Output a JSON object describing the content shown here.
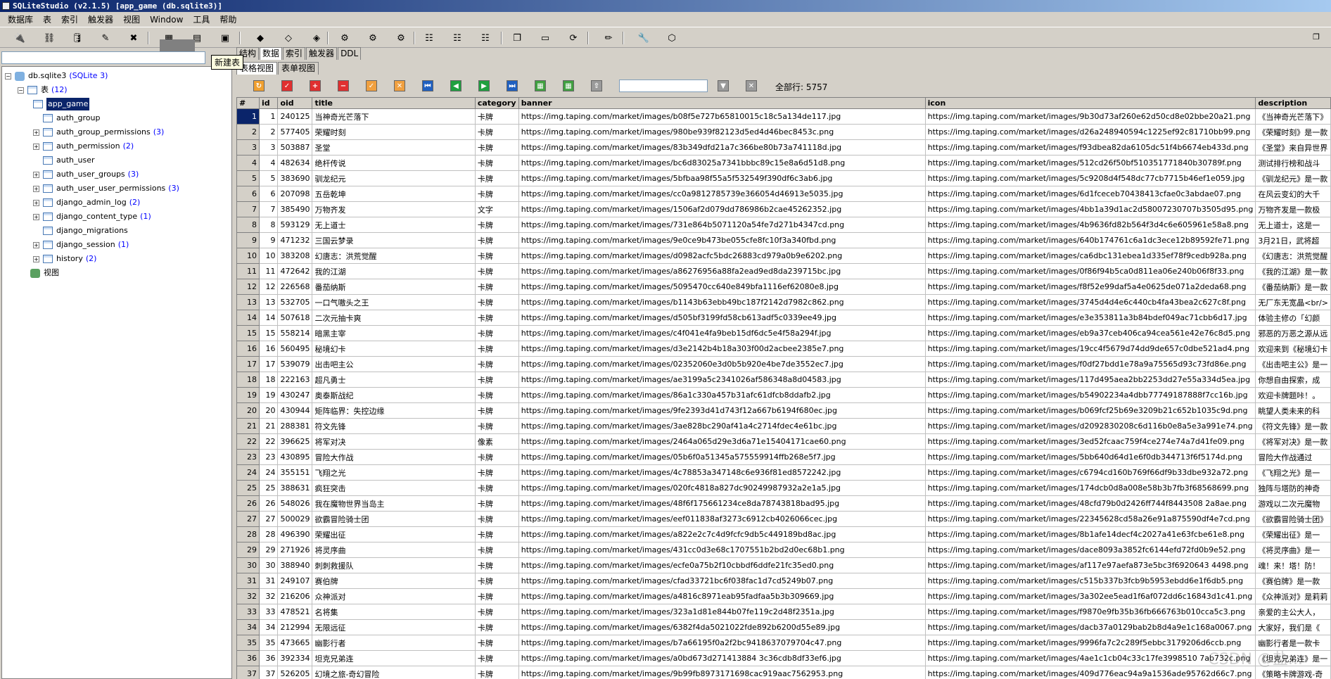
{
  "window": {
    "title": "SQLiteStudio (v2.1.5) [app_game (db.sqlite3)]"
  },
  "menu": [
    "数据库",
    "表",
    "索引",
    "触发器",
    "视图",
    "Window",
    "工具",
    "帮助"
  ],
  "tooltip": "新建表",
  "object_tabs": [
    "结构",
    "数据",
    "索引",
    "触发器",
    "DDL"
  ],
  "view_tabs": [
    "表格视图",
    "表单视图"
  ],
  "total_rows_label": "全部行: 5757",
  "tree": {
    "db_label": "db.sqlite3",
    "db_type": "(SQLite 3)",
    "tables_label": "表",
    "tables_count": "(12)",
    "views_label": "视图",
    "tables": [
      {
        "name": "app_game",
        "count": ""
      },
      {
        "name": "auth_group",
        "count": ""
      },
      {
        "name": "auth_group_permissions",
        "count": "(3)"
      },
      {
        "name": "auth_permission",
        "count": "(2)"
      },
      {
        "name": "auth_user",
        "count": ""
      },
      {
        "name": "auth_user_groups",
        "count": "(3)"
      },
      {
        "name": "auth_user_user_permissions",
        "count": "(3)"
      },
      {
        "name": "django_admin_log",
        "count": "(2)"
      },
      {
        "name": "django_content_type",
        "count": "(1)"
      },
      {
        "name": "django_migrations",
        "count": ""
      },
      {
        "name": "django_session",
        "count": "(1)"
      },
      {
        "name": "history",
        "count": "(2)"
      }
    ]
  },
  "columns": [
    "#",
    "id",
    "oid",
    "title",
    "category",
    "banner",
    "icon",
    "description"
  ],
  "rows": [
    [
      "1",
      "1",
      "240125",
      "当神奇光芒落下",
      "卡牌",
      "https://img.taping.com/market/images/b08f5e727b65810015c18c5a134de117.jpg",
      "https://img.taping.com/market/images/9b30d73af260e62d50cd8e02bbe20a21.png",
      "《当神奇光芒落下》"
    ],
    [
      "2",
      "2",
      "577405",
      "荣耀时刻",
      "卡牌",
      "https://img.taping.com/market/images/980be939f82123d5ed4d46bec8453c.png",
      "https://img.taping.com/market/images/d26a248940594c1225ef92c81710bb99.png",
      "《荣耀时刻》是一款"
    ],
    [
      "3",
      "3",
      "503887",
      "圣堂",
      "卡牌",
      "https://img.taping.com/market/images/83b349dfd21a7c366be80b73a741118d.jpg",
      "https://img.taping.com/market/images/f93dbea82da6105dc51f4b6674eb433d.png",
      "《圣堂》来自异世界"
    ],
    [
      "4",
      "4",
      "482634",
      "绝杆传说",
      "卡牌",
      "https://img.taping.com/market/images/bc6d83025a7341bbbc89c15e8a6d51d8.png",
      "https://img.taping.com/market/images/512cd26f50bf510351771840b30789f.png",
      "测试排行榜和战斗"
    ],
    [
      "5",
      "5",
      "383690",
      "驯龙纪元",
      "卡牌",
      "https://img.taping.com/market/images/5bfbaa98f55a5f532549f390df6c3ab6.jpg",
      "https://img.taping.com/market/images/5c9208d4f548dc77cb7715b46ef1e059.jpg",
      "《驯龙纪元》是一款"
    ],
    [
      "6",
      "6",
      "207098",
      "五岳乾坤",
      "卡牌",
      "https://img.taping.com/market/images/cc0a9812785739e366054d46913e5035.jpg",
      "https://img.taping.com/market/images/6d1fceceb70438413cfae0c3abdae07.png",
      "在风云变幻的大千"
    ],
    [
      "7",
      "7",
      "385490",
      "万物齐发",
      "文字",
      "https://img.taping.com/market/images/1506af2d079dd786986b2cae45262352.jpg",
      "https://img.taping.com/market/images/4bb1a39d1ac2d58007230707b3505d95.png",
      "万物齐发是一款极"
    ],
    [
      "8",
      "8",
      "593129",
      "无上道士",
      "卡牌",
      "https://img.taping.com/market/images/731e864b5071120a54fe7d271b4347cd.png",
      "https://img.taping.com/market/images/4b9636fd82b564f3d4c6e605961e58a8.png",
      "无上道士，这是一"
    ],
    [
      "9",
      "9",
      "471232",
      "三国云梦录",
      "卡牌",
      "https://img.taping.com/market/images/9e0ce9b473be055cfe8fc10f3a340fbd.png",
      "https://img.taping.com/market/images/640b174761c6a1dc3ece12b89592fe71.png",
      "3月21日，武将超"
    ],
    [
      "10",
      "10",
      "383208",
      "幻唐志：洪荒觉醒",
      "卡牌",
      "https://img.taping.com/market/images/d0982acfc5bdc26883cd979a0b9e6202.png",
      "https://img.taping.com/market/images/ca6dbc131ebea1d335ef78f9cedb928a.png",
      "《幻唐志：洪荒觉醒"
    ],
    [
      "11",
      "11",
      "472642",
      "我的江湖",
      "卡牌",
      "https://img.taping.com/market/images/a86276956a88fa2ead9ed8da239715bc.jpg",
      "https://img.taping.com/market/images/0f86f94b5ca0d811ea06e240b06f8f33.png",
      "《我的江湖》是一款"
    ],
    [
      "12",
      "12",
      "226568",
      "番茄纳斯",
      "卡牌",
      "https://img.taping.com/market/images/5095470cc640e849bfa1116ef62080e8.jpg",
      "https://img.taping.com/market/images/f8f52e99daf5a4e0625de071a2deda68.png",
      "《番茄纳斯》是一款"
    ],
    [
      "13",
      "13",
      "532705",
      "一口气嗷头之王",
      "卡牌",
      "https://img.taping.com/market/images/b1143b63ebb49bc187f2142d7982c862.png",
      "https://img.taping.com/market/images/3745d4d4e6c440cb4fa43bea2c627c8f.png",
      "无厂东无宽晶<br/>"
    ],
    [
      "14",
      "14",
      "507618",
      "二次元抽卡爽",
      "卡牌",
      "https://img.taping.com/market/images/d505bf3199fd58cb613adf5c0339ee49.jpg",
      "https://img.taping.com/market/images/e3e353811a3b84bdef049ac71cbb6d17.jpg",
      "体验主修の「幻颜"
    ],
    [
      "15",
      "15",
      "558214",
      "暗黑主宰",
      "卡牌",
      "https://img.taping.com/market/images/c4f041e4fa9beb15df6dc5e4f58a294f.jpg",
      "https://img.taping.com/market/images/eb9a37ceb406ca94cea561e42e76c8d5.png",
      "邪恶的万恶之源从远"
    ],
    [
      "16",
      "16",
      "560495",
      "秘境幻卡",
      "卡牌",
      "https://img.taping.com/market/images/d3e2142b4b18a303f00d2acbee2385e7.png",
      "https://img.taping.com/market/images/19cc4f5679d74dd9de657c0dbe521ad4.png",
      "欢迎来到《秘境幻卡"
    ],
    [
      "17",
      "17",
      "539079",
      "出击吧主公",
      "卡牌",
      "https://img.taping.com/market/images/02352060e3d0b5b920e4be7de3552ec7.jpg",
      "https://img.taping.com/market/images/f0df27bdd1e78a9a75565d93c73fd86e.png",
      "《出击吧主公》是一"
    ],
    [
      "18",
      "18",
      "222163",
      "超凡勇士",
      "卡牌",
      "https://img.taping.com/market/images/ae3199a5c2341026af586348a8d04583.jpg",
      "https://img.taping.com/market/images/117d495aea2bb2253dd27e55a334d5ea.jpg",
      "你想自由探索，成"
    ],
    [
      "19",
      "19",
      "430247",
      "奥泰斯战纪",
      "卡牌",
      "https://img.taping.com/market/images/86a1c330a457b31afc61dfcb8ddafb2.jpg",
      "https://img.taping.com/market/images/b54902234a4dbb77749187888f7cc16b.jpg",
      "欢迎卡牌题咔！。"
    ],
    [
      "20",
      "20",
      "430944",
      "矩阵临界：失控边缘",
      "卡牌",
      "https://img.taping.com/market/images/9fe2393d41d743f12a667b6194f680ec.jpg",
      "https://img.taping.com/market/images/b069fcf25b69e3209b21c652b1035c9d.png",
      "眺望人类未来的科"
    ],
    [
      "21",
      "21",
      "288381",
      "符文先锋",
      "卡牌",
      "https://img.taping.com/market/images/3ae828bc290af41a4c2714fdec4e61bc.jpg",
      "https://img.taping.com/market/images/d2092830208c6d116b0e8a5e3a991e74.png",
      "《符文先锋》是一款"
    ],
    [
      "22",
      "22",
      "396625",
      "将军对决",
      "像素",
      "https://img.taping.com/market/images/2464a065d29e3d6a71e15404171cae60.png",
      "https://img.taping.com/market/images/3ed52fcaac759f4ce274e74a7d41fe09.png",
      "《将军对决》是一款"
    ],
    [
      "23",
      "23",
      "430895",
      "冒险大作战",
      "卡牌",
      "https://img.taping.com/market/images/05b6f0a51345a575559914ffb268e5f7.jpg",
      "https://img.taping.com/market/images/5bb640d64d1e6f0db344713f6f5174d.png",
      "冒险大作战通过"
    ],
    [
      "24",
      "24",
      "355151",
      "飞翔之光",
      "卡牌",
      "https://img.taping.com/market/images/4c78853a347148c6e936f81ed8572242.jpg",
      "https://img.taping.com/market/images/c6794cd160b769f66df9b33dbe932a72.png",
      "《飞翔之光》是一"
    ],
    [
      "25",
      "25",
      "388631",
      "疯狂突击",
      "卡牌",
      "https://img.taping.com/market/images/020fc4818a827dc90249987932a2e1a5.jpg",
      "https://img.taping.com/market/images/174dcb0d8a008e58b3b7fb3f68568699.png",
      "独阵与塔防的神奇"
    ],
    [
      "26",
      "26",
      "548026",
      "我在魔物世界当岛主",
      "卡牌",
      "https://img.taping.com/market/images/48f6f175661234ce8da78743818bad95.jpg",
      "https://img.taping.com/market/images/48cfd79b0d2426ff744f8443508 2a8ae.png",
      "游戏以二次元魔物"
    ],
    [
      "27",
      "27",
      "500029",
      "欲霸冒险骑士团",
      "卡牌",
      "https://img.taping.com/market/images/eef011838af3273c6912cb4026066cec.jpg",
      "https://img.taping.com/market/images/22345628cd58a26e91a875590df4e7cd.png",
      "《欲霸冒险骑士团》"
    ],
    [
      "28",
      "28",
      "496390",
      "荣耀出征",
      "卡牌",
      "https://img.taping.com/market/images/a822e2c7c4d9fcfc9db5c449189bd8ac.jpg",
      "https://img.taping.com/market/images/8b1afe14decf4c2027a41e63fcbe61e8.png",
      "《荣耀出征》是一"
    ],
    [
      "29",
      "29",
      "271926",
      "将灵序曲",
      "卡牌",
      "https://img.taping.com/market/images/431cc0d3e68c1707551b2bd2d0ec68b1.png",
      "https://img.taping.com/market/images/dace8093a3852fc6144efd72fd0b9e52.png",
      "《将灵序曲》是一"
    ],
    [
      "30",
      "30",
      "388940",
      "刺刺救援队",
      "卡牌",
      "https://img.taping.com/market/images/ecfe0a75b2f10cbbdf6ddfe21fc35ed0.png",
      "https://img.taping.com/market/images/af117e97aefa873e5bc3f6920643 4498.png",
      "魂！来！塔！防！"
    ],
    [
      "31",
      "31",
      "249107",
      "赛伯牌",
      "卡牌",
      "https://img.taping.com/market/images/cfad33721bc6f038fac1d7cd5249b07.png",
      "https://img.taping.com/market/images/c515b337b3fcb9b5953ebdd6e1f6db5.png",
      "《赛伯牌》是一款"
    ],
    [
      "32",
      "32",
      "216206",
      "众神派对",
      "卡牌",
      "https://img.taping.com/market/images/a4816c8971eab95fadfaa5b3b309669.jpg",
      "https://img.taping.com/market/images/3a302ee5ead1f6af072dd6c16843d1c41.png",
      "《众神派对》是莉莉"
    ],
    [
      "33",
      "33",
      "478521",
      "名将集",
      "卡牌",
      "https://img.taping.com/market/images/323a1d81e844b07fe119c2d48f2351a.jpg",
      "https://img.taping.com/market/images/f9870e9fb35b36fb666763b010cca5c3.png",
      "亲爱的主公大人，"
    ],
    [
      "34",
      "34",
      "212994",
      "无限远征",
      "卡牌",
      "https://img.taping.com/market/images/6382f4da5021022fde892b6200d55e89.jpg",
      "https://img.taping.com/market/images/dacb37a0129bab2b8d4a9e1c168a0067.png",
      "大家好，我们是《"
    ],
    [
      "35",
      "35",
      "473665",
      "幽影行者",
      "卡牌",
      "https://img.taping.com/market/images/b7a66195f0a2f2bc9418637079704c47.png",
      "https://img.taping.com/market/images/9996fa7c2c289f5ebbc3179206d6ccb.png",
      "幽影行者是一款卡"
    ],
    [
      "36",
      "36",
      "392334",
      "坦克兄弟连",
      "卡牌",
      "https://img.taping.com/market/images/a0bd673d271413884 3c36cdb8df33ef6.jpg",
      "https://img.taping.com/market/images/4ae1c1cb04c33c17fe3998510 7ab732c.png",
      "《坦克兄弟连》是一"
    ],
    [
      "37",
      "37",
      "526205",
      "幻境之旅-奇幻冒险",
      "卡牌",
      "https://img.taping.com/market/images/9b99fb8973171698cac919aac7562953.png",
      "https://img.taping.com/market/images/409d776eac94a9a1536ade95762d66c7.png",
      "《策略卡牌游戏-奇"
    ]
  ],
  "watermark": "CSDN @盐..."
}
